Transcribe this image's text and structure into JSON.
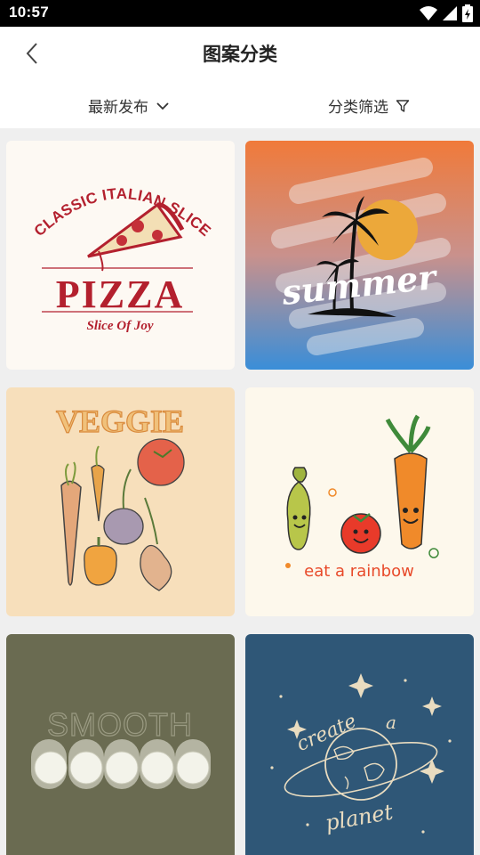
{
  "status": {
    "time": "10:57"
  },
  "header": {
    "title": "图案分类",
    "back_icon": "chevron-left-icon"
  },
  "filters": {
    "sort_label": "最新发布",
    "category_label": "分类筛选"
  },
  "cards": [
    {
      "name": "pizza",
      "bg": "#fdf9f3",
      "accent": "#b3202e",
      "title": "CLASSIC ITALIAN SLICE",
      "word": "PIZZA",
      "tagline": "Slice Of Joy"
    },
    {
      "name": "summer",
      "bg_top": "#f07a3a",
      "bg_bottom": "#3a8ed8",
      "word": "summer"
    },
    {
      "name": "veggie",
      "bg": "#f7dfbb",
      "word": "VEGGIE"
    },
    {
      "name": "rainbow",
      "bg": "#fdf8ec",
      "word": "eat a rainbow"
    },
    {
      "name": "smooth",
      "bg": "#6a6b51",
      "word": "SMOOTH"
    },
    {
      "name": "planet",
      "bg": "#2f5777",
      "word_top": "create",
      "word_mid": "a",
      "word_bottom": "planet"
    }
  ]
}
